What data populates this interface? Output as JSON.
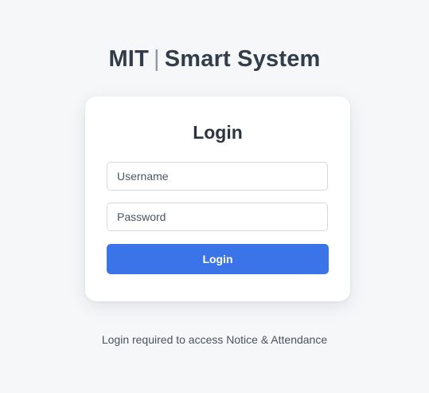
{
  "header": {
    "brand": "MIT",
    "separator": "|",
    "title": "Smart System"
  },
  "login_card": {
    "title": "Login",
    "username_placeholder": "Username",
    "username_value": "",
    "password_placeholder": "Password",
    "password_value": "",
    "submit_label": "Login"
  },
  "footer": {
    "note": "Login required to access Notice & Attendance"
  },
  "colors": {
    "accent": "#3b74e8",
    "background": "#f6f7f9",
    "title_text": "#333d4a"
  }
}
